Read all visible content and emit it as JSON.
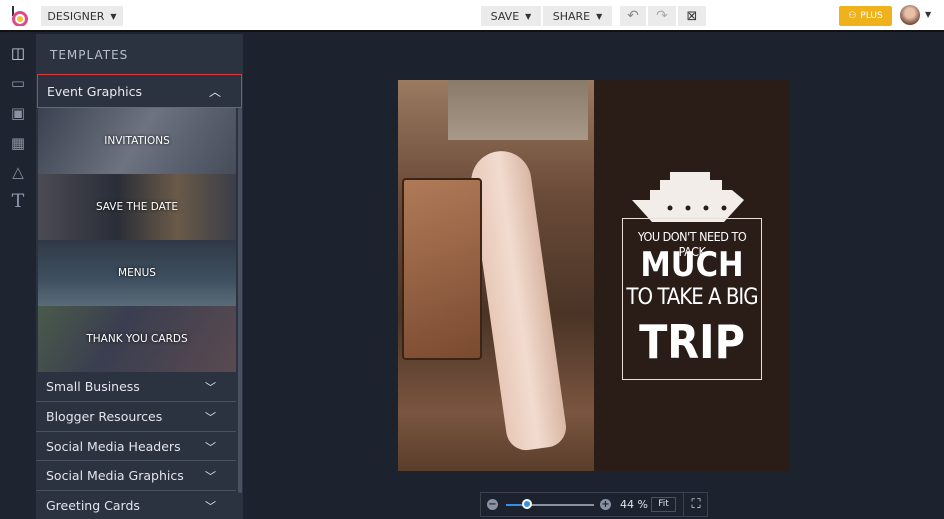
{
  "topbar": {
    "mode_label": "DESIGNER",
    "save_label": "SAVE",
    "share_label": "SHARE",
    "plus_label": "PLUS",
    "accent": "#f0b21c",
    "icons": [
      "logo-icon",
      "undo-icon",
      "redo-icon",
      "close-document-icon",
      "avatar"
    ]
  },
  "rail": {
    "icons": [
      "templates-icon",
      "folder-icon",
      "image-icon",
      "grid-icon",
      "triangle-icon",
      "text-icon"
    ]
  },
  "panel": {
    "title": "TEMPLATES",
    "expanded_category": "Event Graphics",
    "subcategories": [
      "INVITATIONS",
      "SAVE THE DATE",
      "MENUS",
      "THANK YOU CARDS"
    ],
    "categories": [
      "Small Business",
      "Blogger Resources",
      "Social Media Headers",
      "Social Media Graphics",
      "Greeting Cards"
    ]
  },
  "design": {
    "line1": "YOU DON'T NEED TO PACK",
    "line2": "MUCH",
    "line3": "TO TAKE A BIG",
    "line4": "TRIP"
  },
  "zoom": {
    "percent_label": "44 %",
    "value": 44,
    "fit_label": "Fit"
  }
}
